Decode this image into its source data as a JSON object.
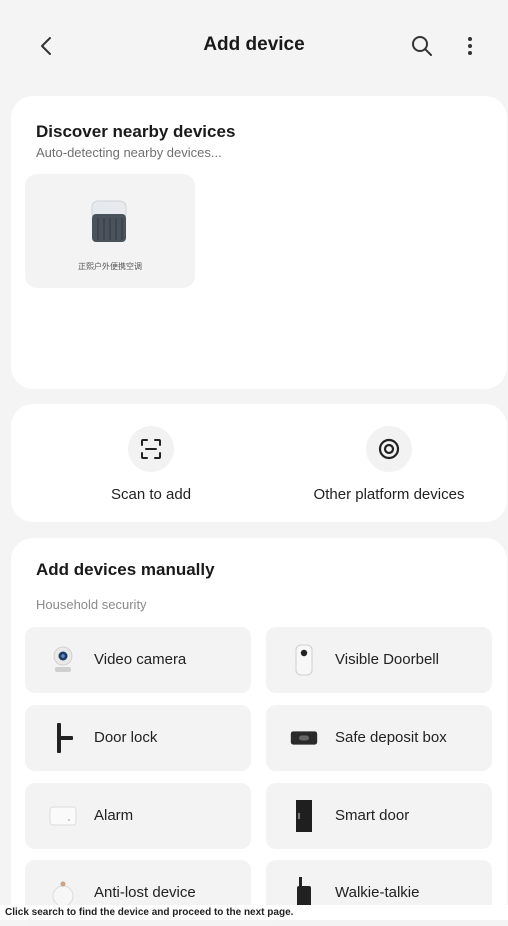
{
  "header": {
    "title": "Add device"
  },
  "discover": {
    "title": "Discover nearby devices",
    "subtitle": "Auto-detecting nearby devices...",
    "nearby_device": "正熙户外便携空调"
  },
  "quick_actions": {
    "scan_label": "Scan to add",
    "other_label": "Other platform devices"
  },
  "manual": {
    "title": "Add devices manually",
    "category": "Household security",
    "devices": [
      {
        "label": "Video camera"
      },
      {
        "label": "Visible Doorbell"
      },
      {
        "label": "Door lock"
      },
      {
        "label": "Safe deposit box"
      },
      {
        "label": "Alarm"
      },
      {
        "label": "Smart door"
      },
      {
        "label": "Anti-lost device"
      },
      {
        "label": "Walkie-talkie"
      }
    ]
  },
  "caption": "Click search to find the device and proceed to the next page.",
  "icons": {
    "back": "back-arrow-icon",
    "search": "search-icon",
    "menu": "more-vertical-icon",
    "scan": "scan-icon",
    "other_platform": "other-platform-icon"
  }
}
